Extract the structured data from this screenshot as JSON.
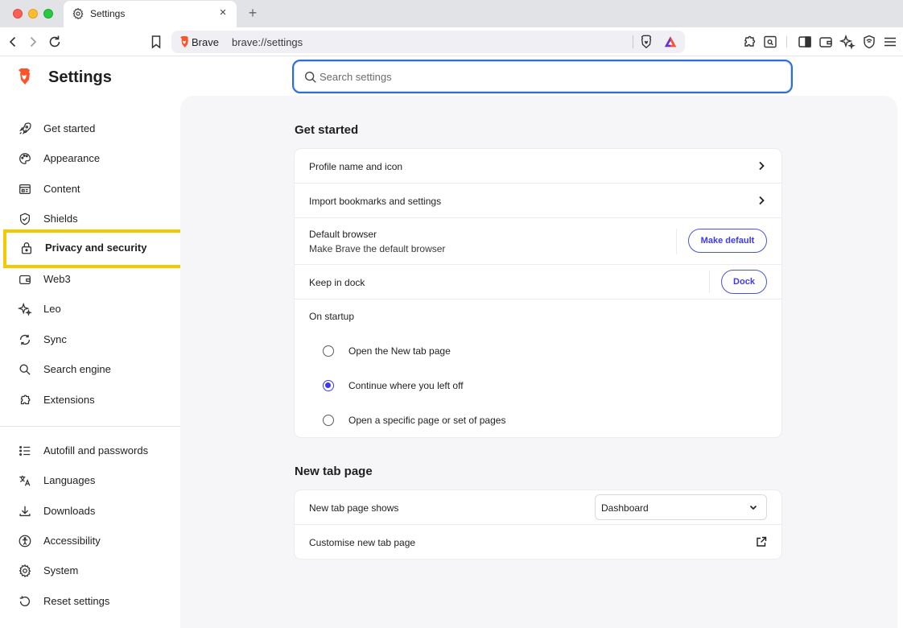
{
  "browser": {
    "tab_title": "Settings",
    "new_tab_symbol": "+",
    "close_symbol": "×",
    "omnibox": {
      "site_label": "Brave",
      "url": "brave://settings"
    }
  },
  "sidebar": {
    "title": "Settings",
    "items": [
      {
        "label": "Get started",
        "icon": "rocket-icon"
      },
      {
        "label": "Appearance",
        "icon": "palette-icon"
      },
      {
        "label": "Content",
        "icon": "content-icon"
      },
      {
        "label": "Shields",
        "icon": "shield-icon"
      },
      {
        "label": "Privacy and security",
        "icon": "lock-icon"
      },
      {
        "label": "Web3",
        "icon": "wallet-icon"
      },
      {
        "label": "Leo",
        "icon": "leo-sparkle-icon"
      },
      {
        "label": "Sync",
        "icon": "sync-icon"
      },
      {
        "label": "Search engine",
        "icon": "search-icon"
      },
      {
        "label": "Extensions",
        "icon": "puzzle-icon"
      },
      {
        "label": "Autofill and passwords",
        "icon": "autofill-list-icon"
      },
      {
        "label": "Languages",
        "icon": "translate-icon"
      },
      {
        "label": "Downloads",
        "icon": "download-icon"
      },
      {
        "label": "Accessibility",
        "icon": "accessibility-icon"
      },
      {
        "label": "System",
        "icon": "gear-icon"
      },
      {
        "label": "Reset settings",
        "icon": "reset-icon"
      }
    ],
    "highlight_color": "#f5c800"
  },
  "search": {
    "placeholder": "Search settings",
    "value": ""
  },
  "get_started": {
    "title": "Get started",
    "profile_name_label": "Profile name and icon",
    "import_label": "Import bookmarks and settings",
    "default_browser_label": "Default browser",
    "default_browser_sub": "Make Brave the default browser",
    "make_default_button": "Make default",
    "keep_in_dock_label": "Keep in dock",
    "dock_button": "Dock",
    "on_startup_label": "On startup",
    "startup_options": [
      {
        "label": "Open the New tab page",
        "selected": false
      },
      {
        "label": "Continue where you left off",
        "selected": true
      },
      {
        "label": "Open a specific page or set of pages",
        "selected": false
      }
    ]
  },
  "new_tab_page": {
    "title": "New tab page",
    "shows_label": "New tab page shows",
    "shows_value": "Dashboard",
    "customise_label": "Customise new tab page"
  },
  "colors": {
    "accent": "#3f39e8",
    "focus_ring": "#2a6fd8",
    "brave_orange": "#fb542b"
  }
}
